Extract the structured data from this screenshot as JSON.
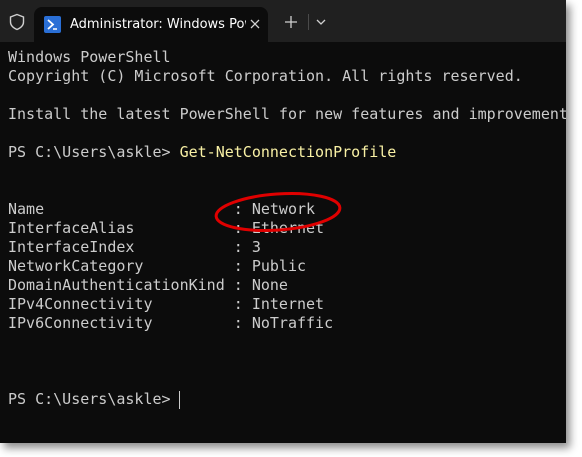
{
  "tab": {
    "title": "Administrator: Windows PowerShell"
  },
  "terminal": {
    "lines": [
      "Windows PowerShell",
      "Copyright (C) Microsoft Corporation. All rights reserved.",
      "Install the latest PowerShell for new features and improvements!"
    ],
    "prompt": "PS C:\\Users\\askle> ",
    "command": "Get-NetConnectionProfile",
    "output": [
      "Name                     : Network",
      "InterfaceAlias           : Ethernet",
      "InterfaceIndex           : 3",
      "NetworkCategory          : Public",
      "DomainAuthenticationKind : None",
      "IPv4Connectivity         : Internet",
      "IPv6Connectivity         : NoTraffic"
    ],
    "final_prompt": "PS C:\\Users\\askle> "
  },
  "icons": {
    "shield": "shield-icon",
    "tab": "powershell-icon",
    "close": "close-icon",
    "add": "plus-icon",
    "dropdown": "chevron-down-icon"
  },
  "colors": {
    "terminal_bg": "#0c0c0c",
    "titlebar_bg": "#202020",
    "text": "#cccccc",
    "command": "#f9f1a5",
    "annotation": "#e00000"
  }
}
